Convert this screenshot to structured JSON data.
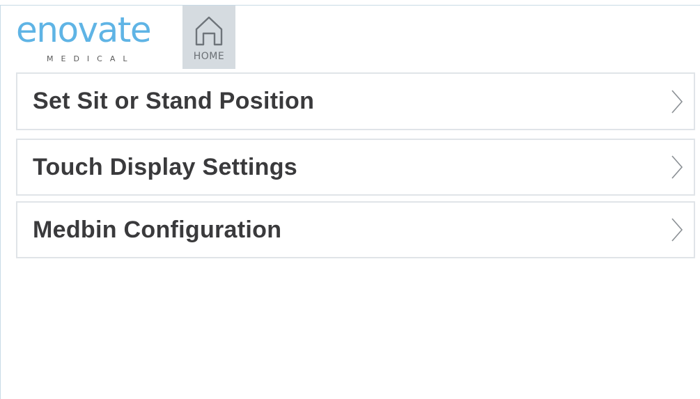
{
  "brand": {
    "name": "enovate",
    "subtitle": "MEDICAL",
    "color": "#5fb4e5"
  },
  "home": {
    "label": "HOME",
    "icon": "home-icon"
  },
  "menu": {
    "items": [
      {
        "label": "Set Sit or Stand Position",
        "icon": "chevron-right-icon"
      },
      {
        "label": "Touch Display Settings",
        "icon": "chevron-right-icon"
      },
      {
        "label": "Medbin Configuration",
        "icon": "chevron-right-icon"
      }
    ]
  }
}
